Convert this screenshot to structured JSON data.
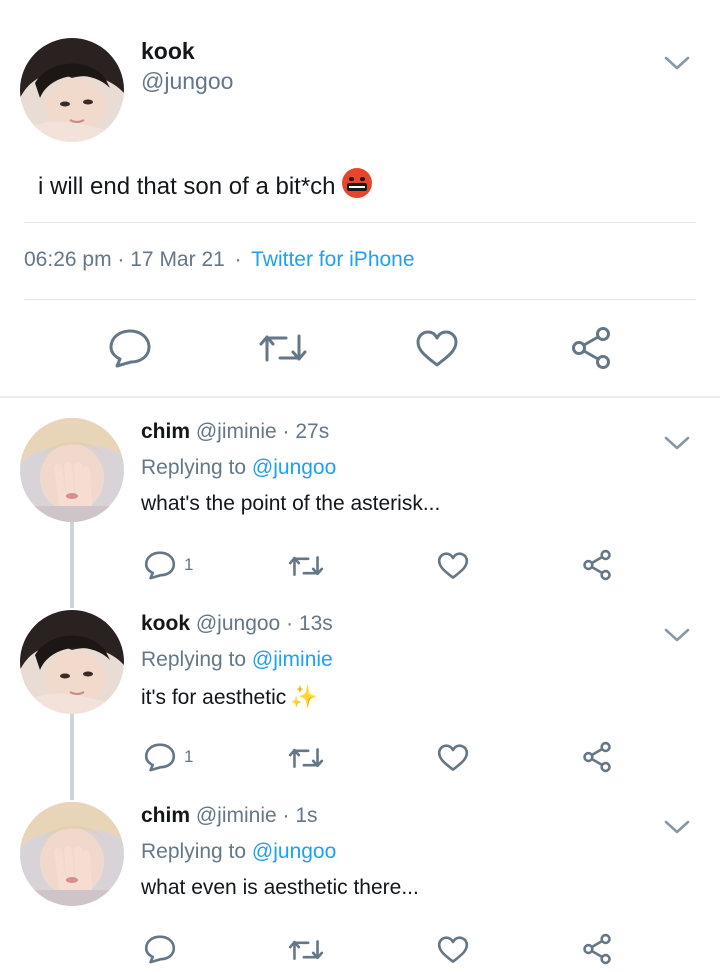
{
  "main_tweet": {
    "name": "kook",
    "handle": "@jungoo",
    "text": "i will end that son of a bit*ch",
    "emoji": "angry-face-symbols-emoji",
    "time": "06:26 pm",
    "date": "17 Mar 21",
    "separator": "·",
    "source": "Twitter for iPhone"
  },
  "replies": [
    {
      "name": "chim",
      "handle": "@jiminie",
      "time": "· 27s",
      "replying_label": "Replying to",
      "replying_to": "@jungoo",
      "text": "what's the point of the asterisk...",
      "reply_count": "1"
    },
    {
      "name": "kook",
      "handle": "@jungoo",
      "time": "· 13s",
      "replying_label": "Replying to",
      "replying_to": "@jiminie",
      "text": "it's for aesthetic",
      "sparkle": "✨",
      "reply_count": "1"
    },
    {
      "name": "chim",
      "handle": "@jiminie",
      "time": "· 1s",
      "replying_label": "Replying to",
      "replying_to": "@jungoo",
      "text": "what even is aesthetic there...",
      "reply_count": ""
    }
  ],
  "colors": {
    "link": "#1da1f2",
    "secondary_text": "#657786",
    "icon": "#657786",
    "divider": "#e1e8ed"
  }
}
